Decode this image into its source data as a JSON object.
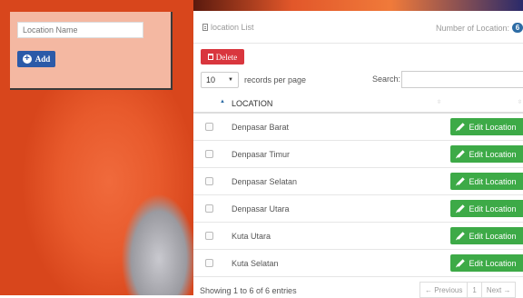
{
  "form": {
    "name_placeholder": "Location Name",
    "add_label": "Add"
  },
  "panel": {
    "title": "location List",
    "count_label": "Number of Location:",
    "count": "6"
  },
  "toolbar": {
    "delete_label": "Delete",
    "page_size": "10",
    "page_size_label": "records per page",
    "search_label": "Search:",
    "search_value": ""
  },
  "table": {
    "columns": [
      "LOCATION"
    ],
    "edit_label": "Edit Location",
    "rows": [
      {
        "name": "Denpasar Barat"
      },
      {
        "name": "Denpasar Timur"
      },
      {
        "name": "Denpasar Selatan"
      },
      {
        "name": "Denpasar Utara"
      },
      {
        "name": "Kuta Utara"
      },
      {
        "name": "Kuta Selatan"
      }
    ]
  },
  "footer": {
    "info": "Showing 1 to 6 of 6 entries",
    "prev": "← Previous",
    "page": "1",
    "next": "Next →"
  }
}
